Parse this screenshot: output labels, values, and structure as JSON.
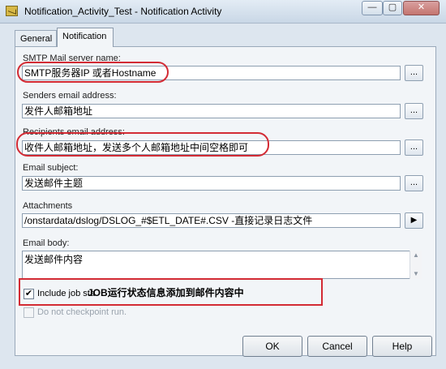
{
  "window": {
    "title": "Notification_Activity_Test - Notification Activity",
    "min_symbol": "—",
    "max_symbol": "▢",
    "close_symbol": "✕"
  },
  "tabs": [
    {
      "label": "General",
      "selected": false
    },
    {
      "label": "Notification",
      "selected": true
    }
  ],
  "fields": {
    "smtp": {
      "label": "SMTP Mail server name:",
      "value": "SMTP服务器IP 或者Hostname",
      "button": "..."
    },
    "senders": {
      "label": "Senders email address:",
      "value": "发件人邮箱地址",
      "button": "..."
    },
    "recipients": {
      "label": "Recipients email address:",
      "value": "收件人邮箱地址，发送多个人邮箱地址中间空格即可",
      "button": "..."
    },
    "subject": {
      "label": "Email subject:",
      "value": "发送邮件主题",
      "button": "..."
    },
    "attachments": {
      "label": "Attachments",
      "value": "/onstardata/dslog/DSLOG_#$ETL_DATE#.CSV -直接记录日志文件",
      "button": "▶"
    },
    "body": {
      "label": "Email body:",
      "value": "发送邮件内容"
    }
  },
  "checkboxes": {
    "include_job_status": {
      "label": "Include job sta",
      "checked": true,
      "mark": "✔"
    },
    "no_checkpoint": {
      "label": "Do not checkpoint run.",
      "checked": false,
      "disabled": true
    }
  },
  "annotation": {
    "text": "JOB运行状态信息添加到邮件内容中",
    "color": "#d32b34"
  },
  "buttons": {
    "ok": "OK",
    "cancel": "Cancel",
    "help": "Help"
  }
}
